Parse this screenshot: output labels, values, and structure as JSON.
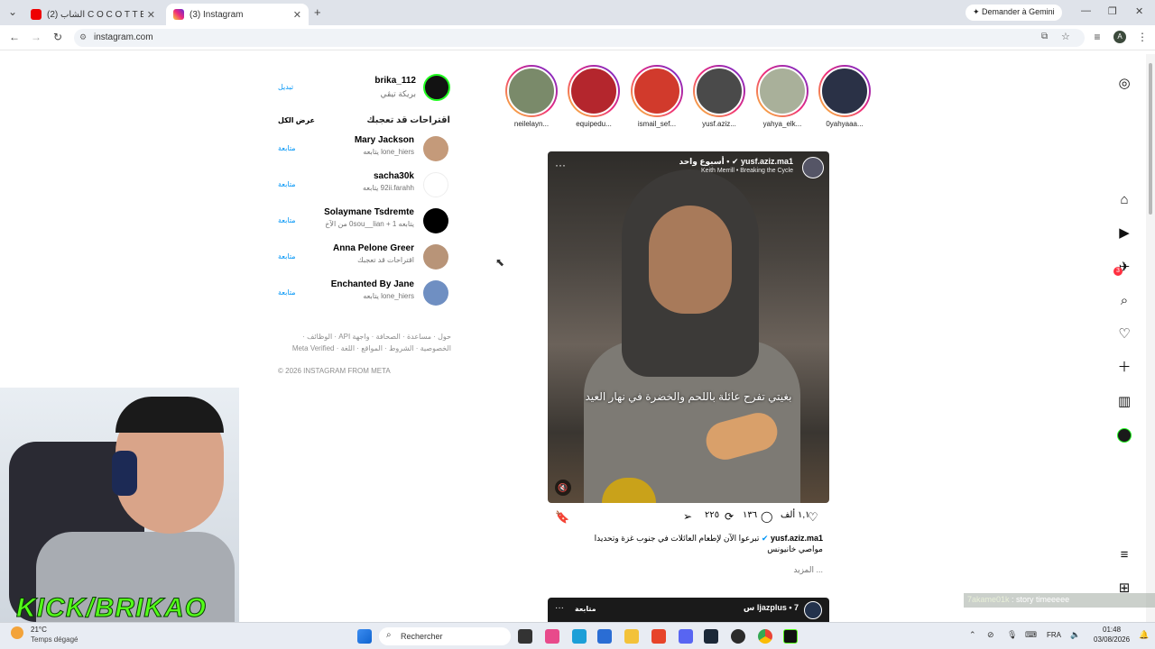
{
  "browser": {
    "tabs": [
      {
        "title": "(2) الشاب C O C O T T E ...",
        "active": false
      },
      {
        "title": "(3) Instagram",
        "active": true
      }
    ],
    "new_tab": "+",
    "url": "instagram.com",
    "gemini_button": "Demander à Gemini",
    "profile_initial": "A"
  },
  "account": {
    "username": "brika_112",
    "fullname": "بريكة تيڤي",
    "switch_label": "تبديل"
  },
  "suggestions": {
    "heading": "اقتراحات قد تعجبك",
    "see_all": "عرض الكل",
    "follow_label": "متابعة",
    "items": [
      {
        "name": "Mary Jackson",
        "sub": "lone_hiers يتابعه",
        "avatar_color": "#c49a7a"
      },
      {
        "name": "sacha30k",
        "sub": "92ii.farahh يتابعه",
        "avatar_color": "#ffffff"
      },
      {
        "name": "Solaymane Tsdremte",
        "sub": "يتابعه 0sou__lian + 1 من الآخ",
        "avatar_color": "#000000"
      },
      {
        "name": "Anna Pelone Greer",
        "sub": "اقتراحات قد تعجبك",
        "avatar_color": "#b89478"
      },
      {
        "name": "Enchanted By Jane",
        "sub": "lone_hiers يتابعه",
        "avatar_color": "#6f8fc2"
      }
    ]
  },
  "footer": {
    "line1": "حول · مساعدة · الصحافة · واجهة API · الوظائف ·",
    "line2": "الخصوصية · الشروط · المواقع · اللغة · Meta Verified",
    "copyright": "© 2026 INSTAGRAM FROM META"
  },
  "stories": [
    {
      "label": "neilelayn...",
      "color": "#7a8a6a"
    },
    {
      "label": "equipedu...",
      "color": "#b4262d"
    },
    {
      "label": "ismail_sef...",
      "color": "#d13a2c"
    },
    {
      "label": "yusf.aziz...",
      "color": "#4a4a4a"
    },
    {
      "label": "yahya_elk...",
      "color": "#a9b09a"
    },
    {
      "label": "0yahyaaa...",
      "color": "#2a3146"
    }
  ],
  "post": {
    "author": "yusf.aziz.ma1",
    "time": "أسبوع واحد",
    "audio": "Keith Merrill • Breaking the Cycle",
    "video_caption": "بغيتي تفرح عائلة باللحم والخضرة في نهار العيد",
    "likes": "١,١ ألف",
    "comments": "١٣٦",
    "reposts": "٢٢٥",
    "caption_author": "yusf.aziz.ma1",
    "caption_line1": "تبرعوا الآن لإطعام العائلات في جنوب غزة وتحديدا",
    "caption_line2": "مواصي خانيونس",
    "more": "... المزيد"
  },
  "next_post": {
    "author": "ljazplus",
    "time": "7 س",
    "follow": "متابعة"
  },
  "sidebar_icons": [
    "instagram-icon",
    "home-icon",
    "reels-icon",
    "messages-icon",
    "search-icon",
    "notifications-icon",
    "create-icon",
    "dashboard-icon",
    "profile-icon",
    "more-icon",
    "also-from-meta-icon"
  ],
  "messages_badge": "3",
  "overlay": {
    "left": "7akame01k",
    "right": ": story timeeeee"
  },
  "webcam": {
    "banner": "KICK/BRIKAO"
  },
  "taskbar": {
    "weather_temp": "21°C",
    "weather_desc": "Temps dégagé",
    "search_placeholder": "Rechercher",
    "lang": "FRA",
    "time": "01:48",
    "date": "03/08/2026"
  }
}
